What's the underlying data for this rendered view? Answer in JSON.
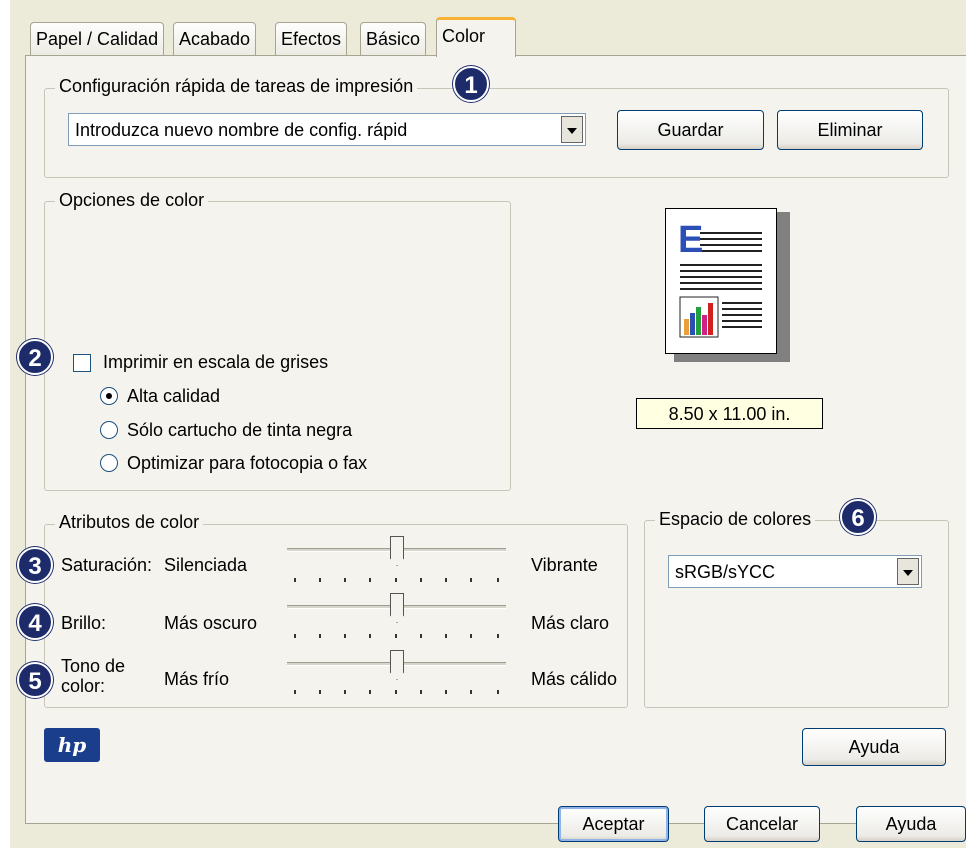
{
  "tabs": [
    {
      "label": "Papel / Calidad"
    },
    {
      "label": "Acabado"
    },
    {
      "label": "Efectos"
    },
    {
      "label": "Básico"
    },
    {
      "label": "Color"
    }
  ],
  "quick_settings": {
    "legend": "Configuración rápida de tareas de impresión",
    "badge": "1",
    "combo_value": "Introduzca nuevo nombre de config. rápid",
    "save_label": "Guardar",
    "delete_label": "Eliminar"
  },
  "color_options": {
    "legend": "Opciones de color",
    "badge": "2",
    "grayscale_label": "Imprimir en escala de grises",
    "grayscale_checked": false,
    "radios": [
      {
        "label": "Alta calidad",
        "selected": true
      },
      {
        "label": "Sólo cartucho de tinta negra",
        "selected": false
      },
      {
        "label": "Optimizar para fotocopia o fax",
        "selected": false
      }
    ]
  },
  "preview": {
    "paper_size": "8.50 x 11.00 in.",
    "letter": "E"
  },
  "color_attributes": {
    "legend": "Atributos de color",
    "rows": [
      {
        "badge": "3",
        "label": "Saturación:",
        "low": "Silenciada",
        "high": "Vibrante",
        "value": 0.5
      },
      {
        "badge": "4",
        "label": "Brillo:",
        "low": "Más oscuro",
        "high": "Más claro",
        "value": 0.5
      },
      {
        "badge": "5",
        "label": "Tono de color:",
        "low": "Más frío",
        "high": "Más cálido",
        "value": 0.5
      }
    ]
  },
  "color_space": {
    "legend": "Espacio de colores",
    "badge": "6",
    "value": "sRGB/sYCC"
  },
  "logo": "hp",
  "panel_help_label": "Ayuda",
  "footer": {
    "ok_label": "Aceptar",
    "cancel_label": "Cancelar",
    "help_label": "Ayuda"
  },
  "colors": {
    "badge": "#1d2b6b",
    "active_tab_accent": "#f7b233",
    "paper_size_bg": "#ffffe1",
    "hp_logo": "#1a3e8c"
  }
}
